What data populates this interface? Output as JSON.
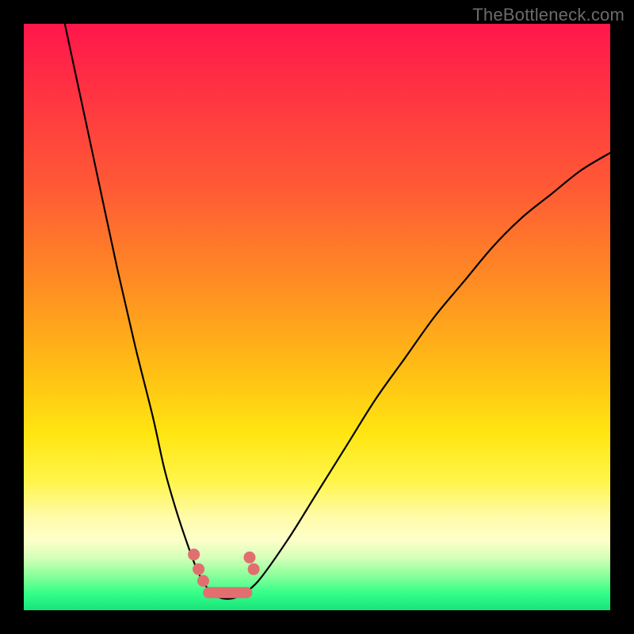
{
  "watermark": "TheBottleneck.com",
  "colors": {
    "frame": "#000000",
    "watermark": "#6b6b6b",
    "curve": "#000000",
    "marker": "#e26f6f",
    "gradient_top": "#ff164b",
    "gradient_bottom": "#17e37a"
  },
  "chart_data": {
    "type": "line",
    "title": "",
    "xlabel": "",
    "ylabel": "",
    "xlim": [
      0,
      100
    ],
    "ylim": [
      0,
      100
    ],
    "grid": false,
    "annotations": [
      "TheBottleneck.com"
    ],
    "series": [
      {
        "name": "left-branch",
        "x": [
          7,
          10,
          13,
          16,
          19,
          22,
          24,
          26,
          28,
          29.5,
          30.5,
          31.5,
          32.5
        ],
        "y": [
          100,
          86,
          72,
          58,
          45,
          33,
          24,
          17,
          11,
          7,
          5,
          3.5,
          2.5
        ]
      },
      {
        "name": "right-branch",
        "x": [
          37,
          40,
          45,
          50,
          55,
          60,
          65,
          70,
          75,
          80,
          85,
          90,
          95,
          100
        ],
        "y": [
          2.5,
          5,
          12,
          20,
          28,
          36,
          43,
          50,
          56,
          62,
          67,
          71,
          75,
          78
        ]
      },
      {
        "name": "valley-floor",
        "x": [
          32.5,
          34,
          35.5,
          37
        ],
        "y": [
          2.5,
          2,
          2,
          2.5
        ]
      }
    ],
    "markers": [
      {
        "x": 29.0,
        "y": 9.5
      },
      {
        "x": 29.8,
        "y": 7.0
      },
      {
        "x": 30.6,
        "y": 5.0
      },
      {
        "x": 38.5,
        "y": 9.0
      },
      {
        "x": 39.2,
        "y": 7.0
      }
    ],
    "marker_segment": {
      "from": {
        "x": 31.5,
        "y": 3.0
      },
      "to": {
        "x": 38.0,
        "y": 3.0
      }
    }
  }
}
